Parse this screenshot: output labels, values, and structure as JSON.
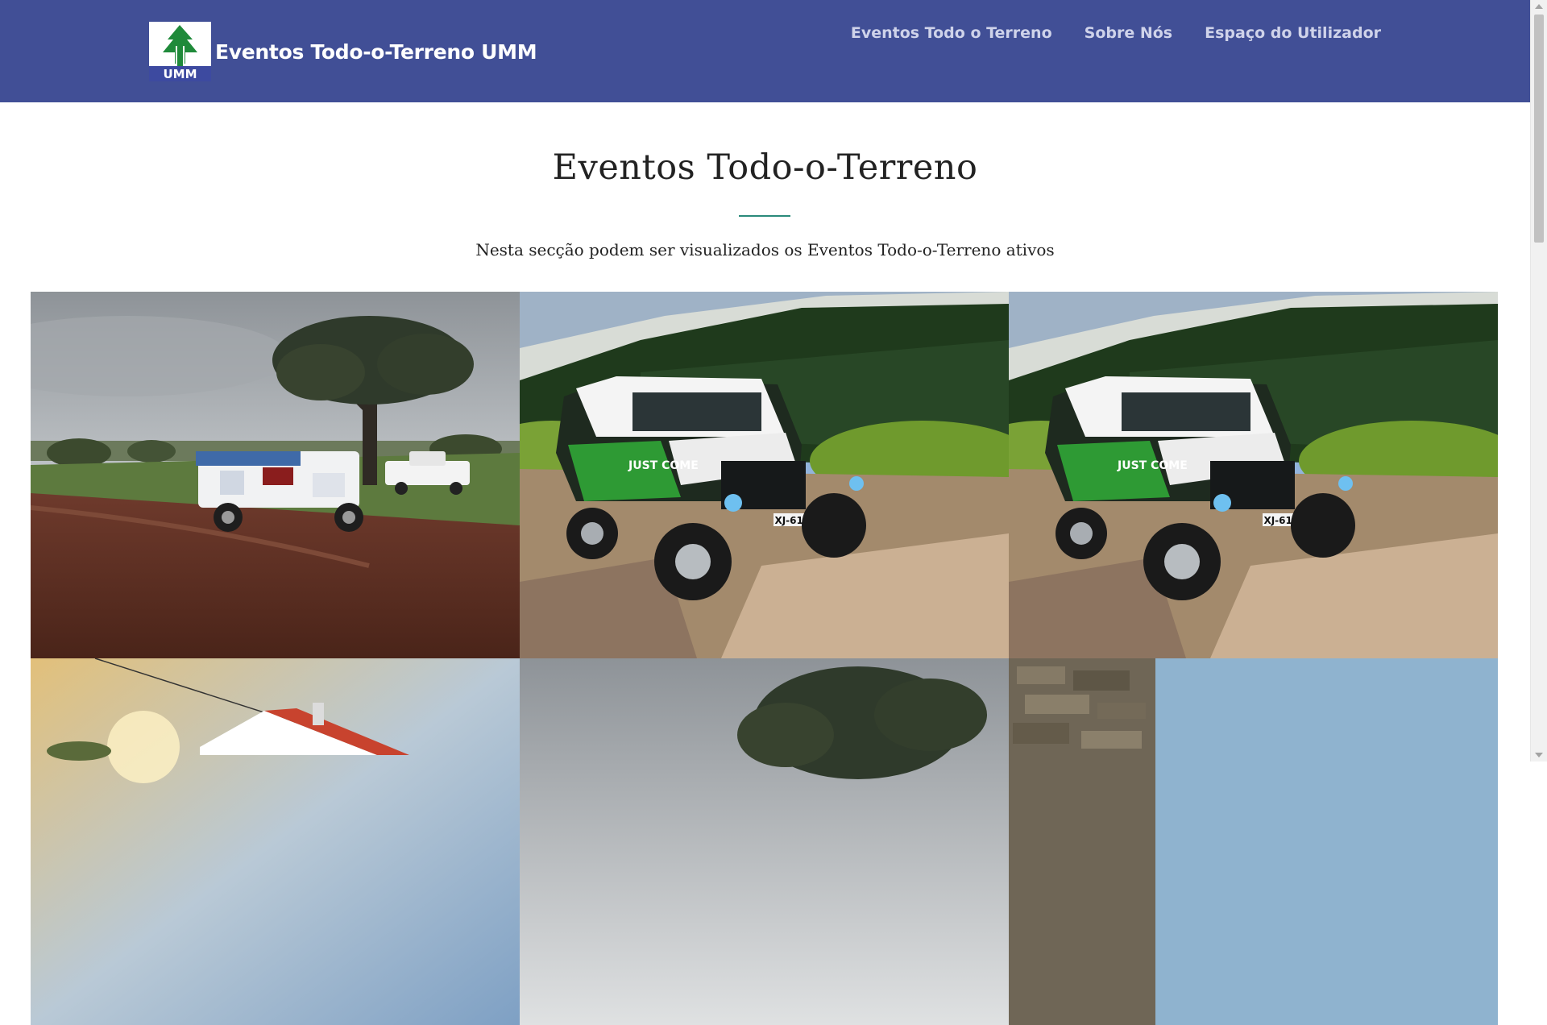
{
  "header": {
    "brand_name": "Eventos Todo-o-Terreno UMM",
    "logo": {
      "icon": "umm-tree-logo-icon",
      "text": "UMM"
    },
    "nav": [
      {
        "label": "Eventos Todo o Terreno"
      },
      {
        "label": "Sobre Nós"
      },
      {
        "label": "Espaço do Utilizador"
      }
    ],
    "colors": {
      "navbar_bg": "#414f96",
      "nav_link": "#cfd3ea",
      "accent_divider": "#2a8a7a"
    }
  },
  "section": {
    "title": "Eventos Todo-o-Terreno",
    "subtitle": "Nesta secção podem ser visualizados os Eventos Todo-o-Terreno ativos"
  },
  "gallery": {
    "items": [
      {
        "scene": "vintage-jeep-cork-tree-photo",
        "plate": ""
      },
      {
        "scene": "umm-jeep-rocky-hill-photo",
        "plate": "XJ-61-04",
        "decal": "JUST COME"
      },
      {
        "scene": "umm-jeep-rocky-hill-photo",
        "plate": "XJ-61-04",
        "decal": "JUST COME"
      },
      {
        "scene": "white-house-sunset-photo",
        "plate": ""
      },
      {
        "scene": "cork-tree-overcast-photo",
        "plate": ""
      },
      {
        "scene": "stone-wall-sky-photo",
        "plate": ""
      }
    ]
  }
}
